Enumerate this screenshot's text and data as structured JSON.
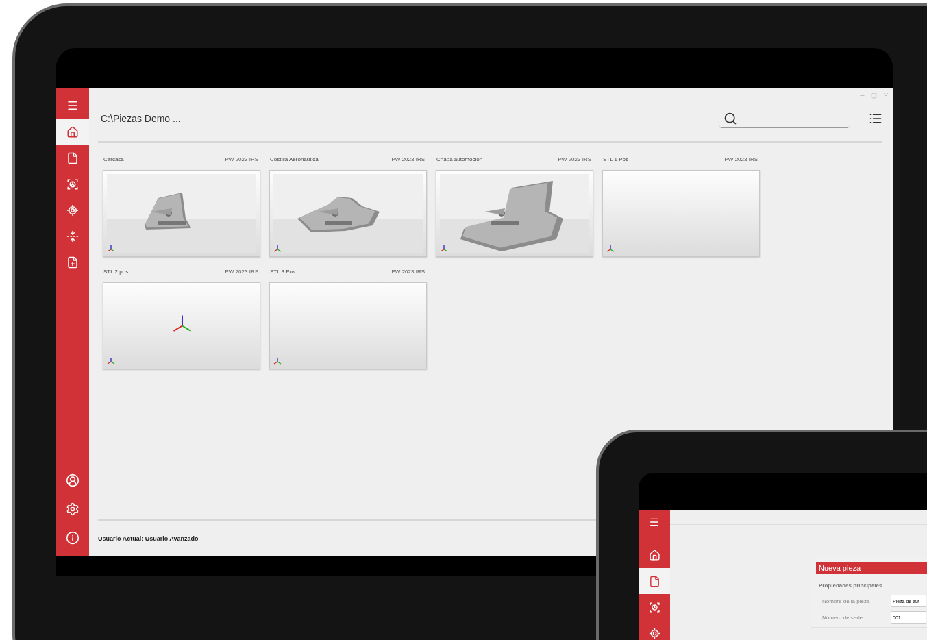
{
  "main_window": {
    "path": "C:\\Piezas Demo ...",
    "sidebar": {
      "items": [
        {
          "kind": "home",
          "selected": true
        },
        {
          "kind": "document",
          "selected": false
        },
        {
          "kind": "scan",
          "selected": false
        },
        {
          "kind": "target",
          "selected": false
        },
        {
          "kind": "align",
          "selected": false
        },
        {
          "kind": "report",
          "selected": false
        }
      ],
      "bottom_items": [
        {
          "kind": "user",
          "selected": false
        },
        {
          "kind": "settings",
          "selected": false
        },
        {
          "kind": "info",
          "selected": false
        }
      ]
    },
    "cards": [
      {
        "name": "Carcasa",
        "version": "PW 2023 IRS",
        "kind": "part"
      },
      {
        "name": "Costilla Aeronautica",
        "version": "PW 2023 IRS",
        "kind": "part"
      },
      {
        "name": "Chapa automoción",
        "version": "PW 2023 IRS",
        "kind": "part"
      },
      {
        "name": "STL 1 Pos",
        "version": "PW 2023 IRS",
        "kind": "empty"
      },
      {
        "name": "STL 2 pos",
        "version": "PW 2023 IRS",
        "kind": "axes"
      },
      {
        "name": "STL 3 Pos",
        "version": "PW 2023 IRS",
        "kind": "empty"
      }
    ],
    "status_bar": "Usuario Actual: Usuario Avanzado"
  },
  "second_window": {
    "sidebar": {
      "items": [
        {
          "kind": "home",
          "selected": false
        },
        {
          "kind": "document",
          "selected": true
        },
        {
          "kind": "scan",
          "selected": false
        },
        {
          "kind": "target",
          "selected": false
        }
      ]
    },
    "panel": {
      "title": "Nueva pieza",
      "section": "Propiedades principales",
      "fields": [
        {
          "label": "Nombre de la pieza",
          "value": "Pieza de aut"
        },
        {
          "label": "Número de serie",
          "value": "001"
        }
      ]
    }
  }
}
